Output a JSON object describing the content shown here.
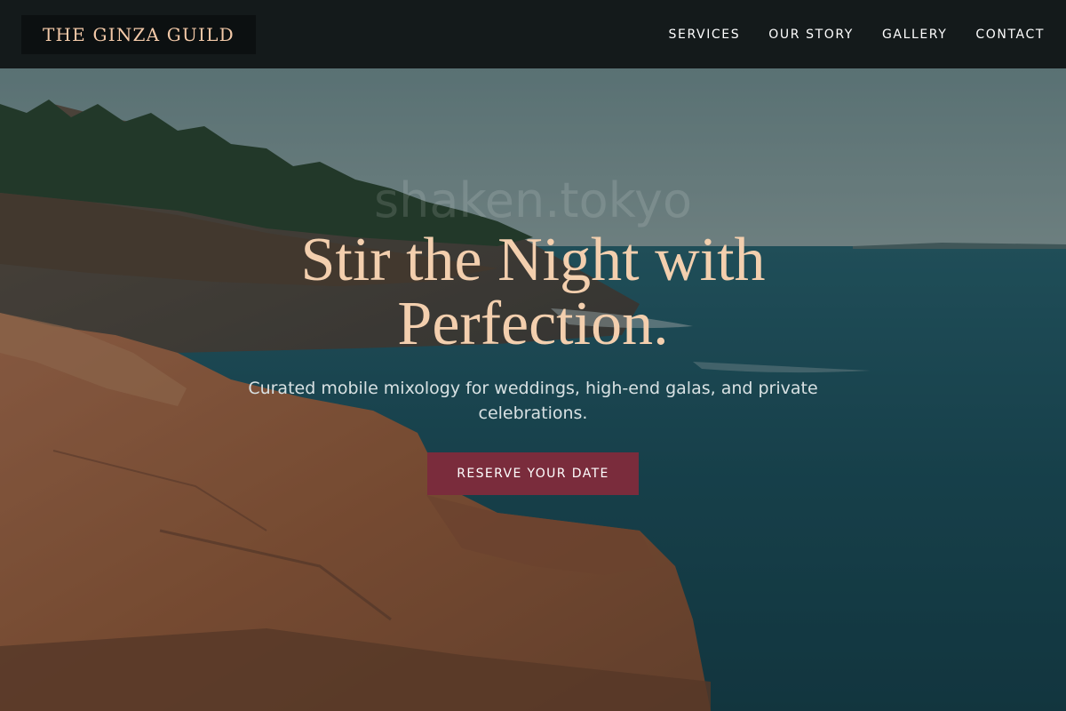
{
  "brand": {
    "name": "THE GINZA GUILD"
  },
  "nav": {
    "items": [
      "SERVICES",
      "OUR STORY",
      "GALLERY",
      "CONTACT"
    ]
  },
  "hero": {
    "headline": "Stir the Night with Perfection.",
    "watermark": "shaken.tokyo",
    "subtitle": "Curated mobile mixology for weddings, high-end galas, and private celebrations.",
    "cta_label": "RESERVE YOUR DATE"
  },
  "colors": {
    "header_bg": "#141a1b",
    "brand_text": "#f3c9a8",
    "headline": "#f3cfae",
    "cta_bg": "#7a2c3c",
    "sea": "#1f5563",
    "rock": "#b06a48"
  }
}
